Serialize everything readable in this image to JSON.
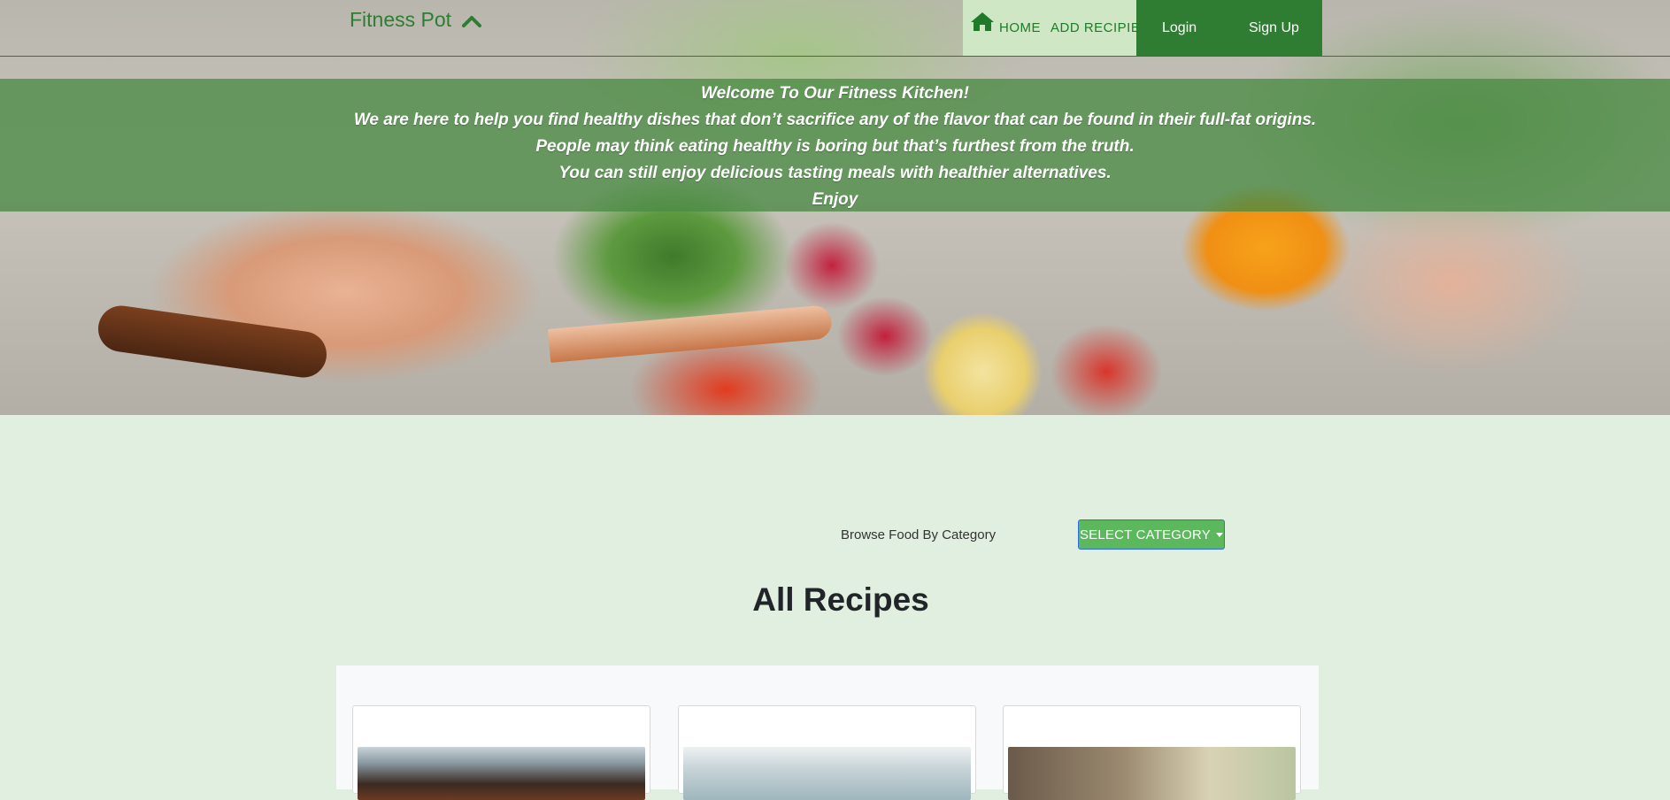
{
  "navbar": {
    "brand": "Fitness Pot",
    "links": [
      {
        "label": "HOME"
      },
      {
        "label": "ADD RECIPIE"
      }
    ],
    "auth": [
      {
        "label": "Login"
      },
      {
        "label": "Sign Up"
      }
    ],
    "colors": {
      "primary_green": "#2e7d32",
      "light_green": "#cfe7c4"
    }
  },
  "hero": {
    "lines": [
      "Welcome To Our Fitness Kitchen!",
      "We are here to help you find healthy dishes that don’t sacrifice any of the flavor that can be found in their full-fat origins.",
      "People may think eating healthy is boring but that’s furthest from the truth.",
      "You can still enjoy delicious tasting meals with healthier alternatives.",
      "Enjoy"
    ]
  },
  "browse": {
    "label": "Browse Food By Category",
    "button_label": "SELECT CATEGORY"
  },
  "recipes": {
    "title": "All Recipes"
  },
  "icons": {
    "brand_chevron": "chevron-up-icon",
    "home": "home-icon",
    "dropdown": "caret-down-icon"
  }
}
